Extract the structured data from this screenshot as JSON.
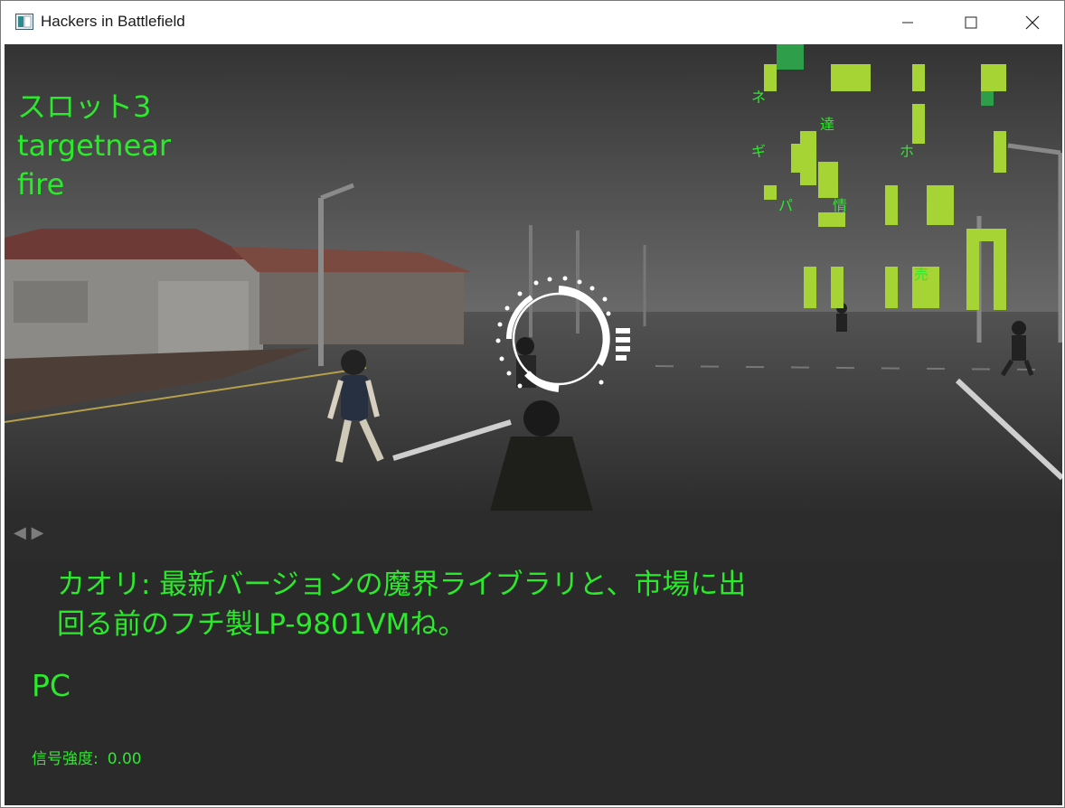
{
  "window": {
    "title": "Hackers in Battlefield",
    "minimize_glyph": "—",
    "maximize_glyph": "☐",
    "close_glyph": "✕"
  },
  "hud": {
    "lines": [
      "スロット3",
      "targetnear",
      "fire"
    ],
    "color": "#2bea2b"
  },
  "map": {
    "labels": [
      "ネ",
      "達",
      "ギ",
      "ホ",
      "パ",
      "情",
      "売"
    ],
    "block_color": "#a6d435"
  },
  "navigation": {
    "prev_glyph": "◀",
    "next_glyph": "▶"
  },
  "dialog": {
    "line1": "カオリ: 最新バージョンの魔界ライブラリと、市場に出",
    "line2": "回る前のフチ製LP-9801VMね。",
    "speaker": "PC",
    "signal_label": "信号強度:",
    "signal_value": "0.00"
  }
}
